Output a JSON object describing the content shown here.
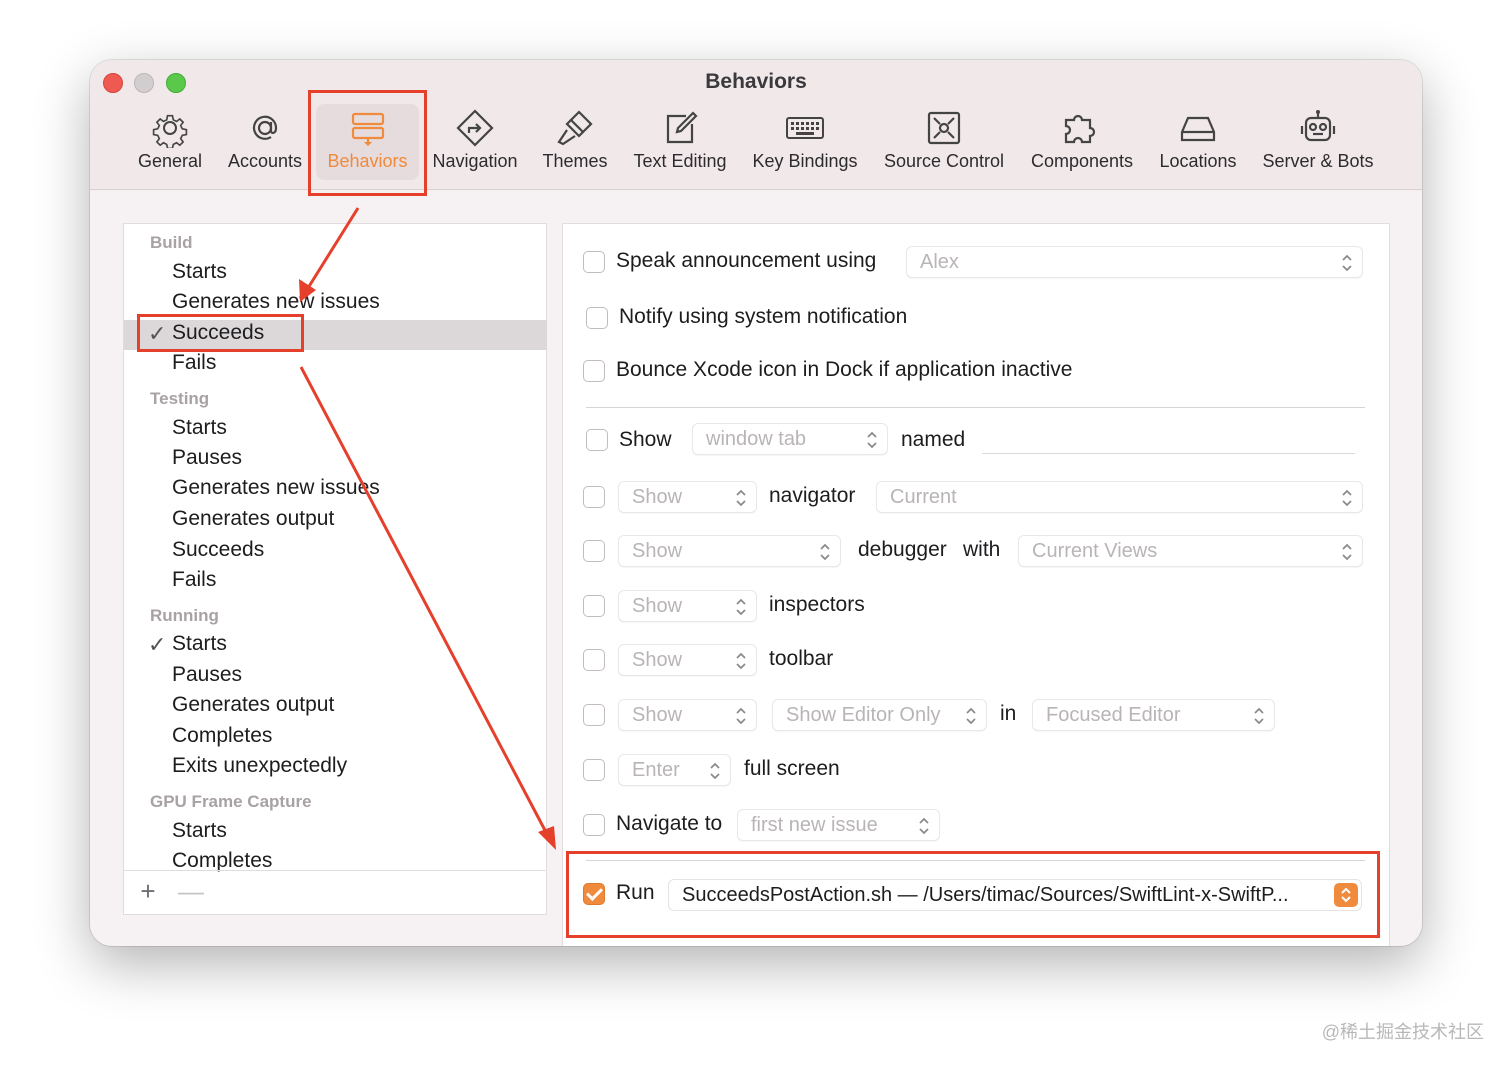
{
  "window": {
    "title": "Behaviors"
  },
  "toolbar": {
    "items": [
      {
        "label": "General",
        "icon": "gear-icon"
      },
      {
        "label": "Accounts",
        "icon": "at-sign-icon"
      },
      {
        "label": "Behaviors",
        "icon": "behaviors-icon",
        "active": true
      },
      {
        "label": "Navigation",
        "icon": "navigation-icon"
      },
      {
        "label": "Themes",
        "icon": "brush-icon"
      },
      {
        "label": "Text Editing",
        "icon": "text-editing-icon"
      },
      {
        "label": "Key Bindings",
        "icon": "keyboard-icon"
      },
      {
        "label": "Source Control",
        "icon": "source-control-icon"
      },
      {
        "label": "Components",
        "icon": "puzzle-icon"
      },
      {
        "label": "Locations",
        "icon": "drive-icon"
      },
      {
        "label": "Server & Bots",
        "icon": "robot-icon"
      }
    ]
  },
  "sidebar": {
    "sections": [
      {
        "title": "Build",
        "items": [
          {
            "label": "Starts"
          },
          {
            "label": "Generates new issues"
          },
          {
            "label": "Succeeds",
            "checked": true,
            "selected": true
          },
          {
            "label": "Fails"
          }
        ]
      },
      {
        "title": "Testing",
        "items": [
          {
            "label": "Starts"
          },
          {
            "label": "Pauses"
          },
          {
            "label": "Generates new issues"
          },
          {
            "label": "Generates output"
          },
          {
            "label": "Succeeds"
          },
          {
            "label": "Fails"
          }
        ]
      },
      {
        "title": "Running",
        "items": [
          {
            "label": "Starts",
            "checked": true
          },
          {
            "label": "Pauses"
          },
          {
            "label": "Generates output"
          },
          {
            "label": "Completes"
          },
          {
            "label": "Exits unexpectedly"
          }
        ]
      },
      {
        "title": "GPU Frame Capture",
        "items": [
          {
            "label": "Starts"
          },
          {
            "label": "Completes"
          }
        ]
      }
    ],
    "add_glyph": "+",
    "remove_glyph": "—"
  },
  "options": {
    "speak": {
      "label": "Speak announcement using",
      "voice": "Alex",
      "checked": false
    },
    "notify": {
      "label": "Notify using system notification",
      "checked": false
    },
    "bounce": {
      "label": "Bounce Xcode icon in Dock if application inactive",
      "checked": false
    },
    "show_tab": {
      "label": "Show",
      "popup": "window tab",
      "named": "named",
      "checked": false
    },
    "navigator": {
      "popup": "Show",
      "label": "navigator",
      "value": "Current",
      "checked": false
    },
    "debugger": {
      "popup": "Show",
      "label": "debugger",
      "with": "with",
      "value": "Current Views",
      "checked": false
    },
    "inspectors": {
      "popup": "Show",
      "label": "inspectors",
      "checked": false
    },
    "toolbar": {
      "popup": "Show",
      "label": "toolbar",
      "checked": false
    },
    "editor": {
      "popup": "Show",
      "mode": "Show Editor Only",
      "in": "in",
      "target": "Focused Editor",
      "checked": false
    },
    "fullscreen": {
      "popup": "Enter",
      "label": "full screen",
      "checked": false
    },
    "navigate": {
      "label": "Navigate to",
      "popup": "first new issue",
      "checked": false
    },
    "run": {
      "label": "Run",
      "script": "SucceedsPostAction.sh — /Users/timac/Sources/SwiftLint-x-SwiftP...",
      "checked": true
    }
  },
  "colors": {
    "accent": "#f08a3c",
    "annotation": "#e5402b"
  },
  "watermark": "@稀土掘金技术社区"
}
